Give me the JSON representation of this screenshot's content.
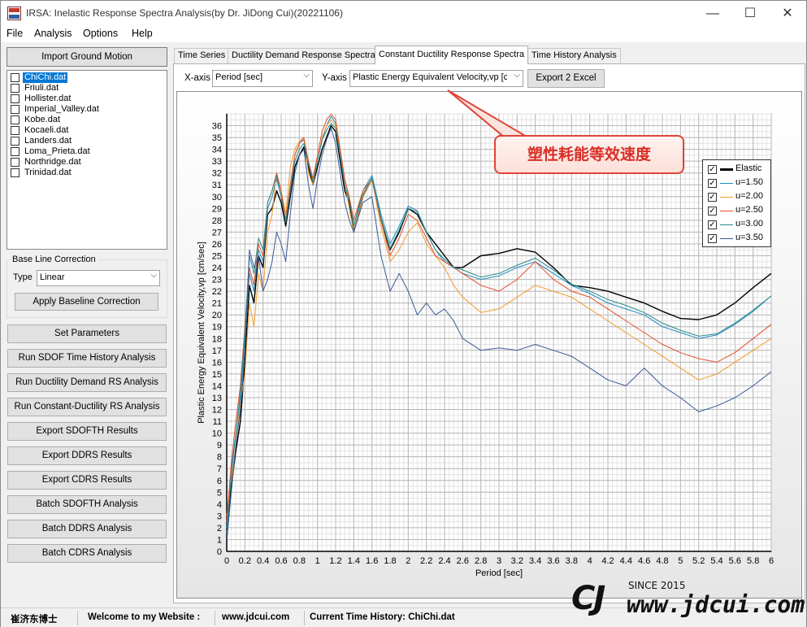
{
  "window": {
    "title": "IRSA: Inelastic Response Spectra Analysis(by Dr. JiDong Cui)(20221106)",
    "minimize_glyph": "—",
    "maximize_glyph": "☐",
    "close_glyph": "✕"
  },
  "menu": [
    "File",
    "Analysis",
    "Options",
    "Help"
  ],
  "left": {
    "import_button": "Import Ground Motion",
    "files": [
      {
        "name": "ChiChi.dat",
        "selected": true
      },
      {
        "name": "Friuli.dat",
        "selected": false
      },
      {
        "name": "Hollister.dat",
        "selected": false
      },
      {
        "name": "Imperial_Valley.dat",
        "selected": false
      },
      {
        "name": "Kobe.dat",
        "selected": false
      },
      {
        "name": "Kocaeli.dat",
        "selected": false
      },
      {
        "name": "Landers.dat",
        "selected": false
      },
      {
        "name": "Loma_Prieta.dat",
        "selected": false
      },
      {
        "name": "Northridge.dat",
        "selected": false
      },
      {
        "name": "Trinidad.dat",
        "selected": false
      }
    ],
    "baseline_group_title": "Base Line Correction",
    "type_label": "Type",
    "type_value": "Linear",
    "apply_baseline_button": "Apply Baseline Correction",
    "action_buttons": [
      "Set Parameters",
      "Run SDOF Time History Analysis",
      "Run Ductility Demand RS Analysis",
      "Run Constant-Ductility RS Analysis",
      "Export SDOFTH Results",
      "Export DDRS Results",
      "Export CDRS Results",
      "Batch SDOFTH Analysis",
      "Batch DDRS Analysis",
      "Batch CDRS Analysis"
    ]
  },
  "tabs": [
    {
      "label": "Time Series",
      "active": false
    },
    {
      "label": "Ductility Demand Response Spectra",
      "active": false
    },
    {
      "label": "Constant Ductility Response Spectra",
      "active": true
    },
    {
      "label": "Time History Analysis",
      "active": false
    }
  ],
  "controls": {
    "xaxis_label": "X-axis",
    "xaxis_value": "Period [sec]",
    "yaxis_label": "Y-axis",
    "yaxis_value": "Plastic Energy Equivalent Velocity,vp [cm",
    "export_button": "Export 2 Excel"
  },
  "annotation": {
    "text": "塑性耗能等效速度",
    "color": "#d92f26"
  },
  "chart_data": {
    "type": "line",
    "xlabel": "Period [sec]",
    "ylabel": "Plastic Energy Equivalent Velocity,vp [cm/sec]",
    "xlim": [
      0,
      6
    ],
    "ylim": [
      0,
      37
    ],
    "xticks": [
      "0",
      "0.2",
      "0.4",
      "0.6",
      "0.8",
      "1",
      "1.2",
      "1.4",
      "1.6",
      "1.8",
      "2",
      "2.2",
      "2.4",
      "2.6",
      "2.8",
      "3",
      "3.2",
      "3.4",
      "3.6",
      "3.8",
      "4",
      "4.2",
      "4.4",
      "4.6",
      "4.8",
      "5",
      "5.2",
      "5.4",
      "5.6",
      "5.8",
      "6"
    ],
    "yticks": [
      "0",
      "1",
      "2",
      "3",
      "4",
      "5",
      "6",
      "7",
      "8",
      "9",
      "10",
      "11",
      "12",
      "13",
      "14",
      "15",
      "16",
      "17",
      "18",
      "19",
      "20",
      "21",
      "22",
      "23",
      "24",
      "25",
      "26",
      "27",
      "28",
      "29",
      "30",
      "31",
      "32",
      "33",
      "34",
      "35",
      "36"
    ],
    "grid": true,
    "legend_position": "top-right",
    "series": [
      {
        "name": "Elastic",
        "color": "#000000",
        "x": [
          0,
          0.05,
          0.1,
          0.15,
          0.2,
          0.25,
          0.3,
          0.35,
          0.4,
          0.45,
          0.5,
          0.55,
          0.6,
          0.65,
          0.7,
          0.75,
          0.8,
          0.85,
          0.9,
          0.95,
          1.0,
          1.05,
          1.1,
          1.15,
          1.2,
          1.25,
          1.3,
          1.35,
          1.4,
          1.5,
          1.6,
          1.7,
          1.8,
          1.9,
          2.0,
          2.1,
          2.2,
          2.3,
          2.4,
          2.5,
          2.6,
          2.8,
          3.0,
          3.2,
          3.4,
          3.6,
          3.8,
          4.0,
          4.2,
          4.4,
          4.6,
          4.8,
          5.0,
          5.2,
          5.4,
          5.6,
          5.8,
          6.0
        ],
        "values": [
          1.0,
          5.5,
          8.5,
          11.0,
          16.0,
          22.5,
          21.0,
          25.0,
          24.0,
          28.5,
          29.0,
          30.5,
          29.5,
          27.5,
          30.0,
          32.5,
          33.5,
          34.2,
          32.5,
          31.0,
          32.5,
          34.0,
          35.0,
          36.0,
          35.5,
          33.0,
          30.5,
          29.5,
          27.0,
          30.0,
          31.5,
          28.0,
          25.5,
          27.0,
          29.0,
          28.5,
          27.0,
          26.0,
          25.0,
          24.0,
          24.0,
          25.0,
          25.2,
          25.6,
          25.3,
          24.0,
          22.5,
          22.3,
          22.0,
          21.5,
          21.0,
          20.3,
          19.7,
          19.6,
          20.0,
          21.0,
          22.3,
          23.5
        ]
      },
      {
        "name": "u=1.50",
        "color": "#1f8ac0",
        "x": [
          0,
          0.05,
          0.1,
          0.15,
          0.2,
          0.25,
          0.3,
          0.35,
          0.4,
          0.45,
          0.5,
          0.55,
          0.6,
          0.65,
          0.7,
          0.75,
          0.8,
          0.85,
          0.9,
          0.95,
          1.0,
          1.05,
          1.1,
          1.15,
          1.2,
          1.25,
          1.3,
          1.35,
          1.4,
          1.5,
          1.6,
          1.7,
          1.8,
          1.9,
          2.0,
          2.1,
          2.2,
          2.3,
          2.4,
          2.5,
          2.6,
          2.8,
          3.0,
          3.2,
          3.4,
          3.6,
          3.8,
          4.0,
          4.2,
          4.4,
          4.6,
          4.8,
          5.0,
          5.2,
          5.4,
          5.6,
          5.8,
          6.0
        ],
        "values": [
          2.0,
          7.0,
          10.0,
          13.0,
          18.0,
          23.5,
          22.0,
          25.5,
          24.5,
          29.0,
          30.0,
          31.5,
          30.0,
          28.0,
          31.0,
          33.5,
          34.5,
          34.8,
          33.0,
          31.5,
          33.0,
          34.8,
          36.0,
          36.8,
          36.2,
          33.5,
          31.0,
          29.8,
          27.5,
          30.5,
          31.8,
          28.5,
          26.0,
          27.5,
          29.2,
          28.8,
          27.0,
          25.5,
          24.5,
          24.0,
          23.5,
          23.0,
          23.3,
          24.0,
          24.5,
          23.5,
          22.5,
          21.8,
          21.0,
          20.5,
          20.0,
          19.0,
          18.5,
          18.0,
          18.3,
          19.2,
          20.3,
          21.6
        ]
      },
      {
        "name": "u=2.00",
        "color": "#f39c2a",
        "x": [
          0,
          0.05,
          0.1,
          0.15,
          0.2,
          0.25,
          0.3,
          0.35,
          0.4,
          0.45,
          0.5,
          0.55,
          0.6,
          0.65,
          0.7,
          0.75,
          0.8,
          0.85,
          0.9,
          0.95,
          1.0,
          1.05,
          1.1,
          1.15,
          1.2,
          1.25,
          1.3,
          1.35,
          1.4,
          1.5,
          1.6,
          1.7,
          1.8,
          1.9,
          2.0,
          2.1,
          2.2,
          2.3,
          2.4,
          2.5,
          2.6,
          2.8,
          3.0,
          3.2,
          3.4,
          3.6,
          3.8,
          4.0,
          4.2,
          4.4,
          4.6,
          4.8,
          5.0,
          5.2,
          5.4,
          5.6,
          5.8,
          6.0
        ],
        "values": [
          3.0,
          6.0,
          9.0,
          12.5,
          15.0,
          21.0,
          19.0,
          23.5,
          22.0,
          27.0,
          28.5,
          32.0,
          30.5,
          28.5,
          32.5,
          34.0,
          34.7,
          35.0,
          32.0,
          31.0,
          33.0,
          35.0,
          36.0,
          36.5,
          36.0,
          33.8,
          31.2,
          29.0,
          27.0,
          30.0,
          31.5,
          27.5,
          24.5,
          25.5,
          27.0,
          27.8,
          26.0,
          25.0,
          24.0,
          22.5,
          21.5,
          20.2,
          20.5,
          21.5,
          22.5,
          22.0,
          21.5,
          20.5,
          19.5,
          18.5,
          17.5,
          16.5,
          15.5,
          14.5,
          15.0,
          16.0,
          17.0,
          18.0
        ]
      },
      {
        "name": "u=2.50",
        "color": "#e4512b",
        "x": [
          0,
          0.05,
          0.1,
          0.15,
          0.2,
          0.25,
          0.3,
          0.35,
          0.4,
          0.45,
          0.5,
          0.55,
          0.6,
          0.65,
          0.7,
          0.75,
          0.8,
          0.85,
          0.9,
          0.95,
          1.0,
          1.05,
          1.1,
          1.15,
          1.2,
          1.25,
          1.3,
          1.35,
          1.4,
          1.5,
          1.6,
          1.7,
          1.8,
          1.9,
          2.0,
          2.1,
          2.2,
          2.3,
          2.4,
          2.5,
          2.6,
          2.8,
          3.0,
          3.2,
          3.4,
          3.6,
          3.8,
          4.0,
          4.2,
          4.4,
          4.6,
          4.8,
          5.0,
          5.2,
          5.4,
          5.6,
          5.8,
          6.0
        ],
        "values": [
          2.5,
          7.5,
          11.0,
          14.0,
          19.0,
          24.0,
          22.5,
          26.0,
          25.0,
          29.5,
          30.5,
          32.0,
          30.5,
          28.0,
          31.0,
          33.5,
          34.5,
          35.0,
          33.0,
          31.5,
          33.5,
          35.5,
          36.5,
          37.0,
          36.5,
          34.0,
          31.5,
          30.0,
          28.0,
          30.5,
          31.5,
          28.0,
          25.0,
          26.5,
          28.5,
          28.0,
          26.5,
          25.0,
          24.5,
          24.0,
          23.5,
          22.5,
          22.0,
          23.0,
          24.5,
          23.0,
          22.0,
          21.5,
          20.5,
          19.5,
          18.5,
          17.5,
          16.8,
          16.3,
          16.0,
          16.8,
          18.0,
          19.2
        ]
      },
      {
        "name": "u=3.00",
        "color": "#2a8a8a",
        "x": [
          0,
          0.05,
          0.1,
          0.15,
          0.2,
          0.25,
          0.3,
          0.35,
          0.4,
          0.45,
          0.5,
          0.55,
          0.6,
          0.65,
          0.7,
          0.75,
          0.8,
          0.85,
          0.9,
          0.95,
          1.0,
          1.05,
          1.1,
          1.15,
          1.2,
          1.25,
          1.3,
          1.35,
          1.4,
          1.5,
          1.6,
          1.7,
          1.8,
          1.9,
          2.0,
          2.1,
          2.2,
          2.3,
          2.4,
          2.5,
          2.6,
          2.8,
          3.0,
          3.2,
          3.4,
          3.6,
          3.8,
          4.0,
          4.2,
          4.4,
          4.6,
          4.8,
          5.0,
          5.2,
          5.4,
          5.6,
          5.8,
          6.0
        ],
        "values": [
          1.5,
          6.5,
          10.0,
          13.5,
          18.5,
          25.0,
          23.5,
          26.5,
          25.5,
          29.5,
          30.5,
          31.8,
          30.0,
          27.8,
          30.5,
          33.0,
          34.0,
          34.5,
          32.8,
          31.2,
          33.0,
          34.8,
          35.6,
          36.2,
          35.8,
          33.5,
          31.0,
          29.7,
          27.5,
          30.2,
          31.6,
          28.2,
          25.6,
          27.2,
          29.0,
          28.7,
          27.0,
          25.5,
          24.7,
          24.0,
          23.8,
          23.2,
          23.5,
          24.2,
          24.8,
          23.8,
          22.6,
          22.0,
          21.3,
          20.8,
          20.2,
          19.3,
          18.7,
          18.2,
          18.4,
          19.3,
          20.4,
          21.6
        ]
      },
      {
        "name": "u=3.50",
        "color": "#3a5a9a",
        "x": [
          0,
          0.05,
          0.1,
          0.15,
          0.2,
          0.25,
          0.3,
          0.35,
          0.4,
          0.45,
          0.5,
          0.55,
          0.6,
          0.65,
          0.7,
          0.75,
          0.8,
          0.85,
          0.9,
          0.95,
          1.0,
          1.05,
          1.1,
          1.15,
          1.2,
          1.25,
          1.3,
          1.35,
          1.4,
          1.5,
          1.6,
          1.7,
          1.8,
          1.9,
          2.0,
          2.1,
          2.2,
          2.3,
          2.4,
          2.5,
          2.6,
          2.8,
          3.0,
          3.2,
          3.4,
          3.6,
          3.8,
          4.0,
          4.2,
          4.4,
          4.6,
          4.8,
          5.0,
          5.2,
          5.4,
          5.6,
          5.8,
          6.0
        ],
        "values": [
          1.0,
          5.0,
          9.0,
          12.0,
          17.0,
          25.5,
          24.0,
          25.0,
          22.0,
          23.0,
          24.5,
          27.0,
          26.0,
          24.5,
          28.5,
          32.0,
          33.5,
          34.0,
          31.0,
          29.0,
          31.5,
          33.5,
          34.8,
          35.8,
          34.5,
          32.0,
          29.5,
          28.0,
          27.0,
          29.5,
          30.0,
          25.0,
          22.0,
          23.5,
          22.0,
          20.0,
          21.0,
          20.0,
          20.5,
          19.5,
          18.0,
          17.0,
          17.2,
          17.0,
          17.5,
          17.0,
          16.5,
          15.5,
          14.5,
          14.0,
          15.5,
          14.0,
          13.0,
          11.8,
          12.3,
          13.0,
          14.0,
          15.2
        ]
      }
    ]
  },
  "status": {
    "author": "崔济东博士",
    "welcome": "Welcome to my Website :",
    "website": "www.jdcui.com",
    "current": "Current Time History: ChiChi.dat"
  },
  "watermark": {
    "since": "SINCE 2015",
    "url": "www.jdcui.com"
  }
}
